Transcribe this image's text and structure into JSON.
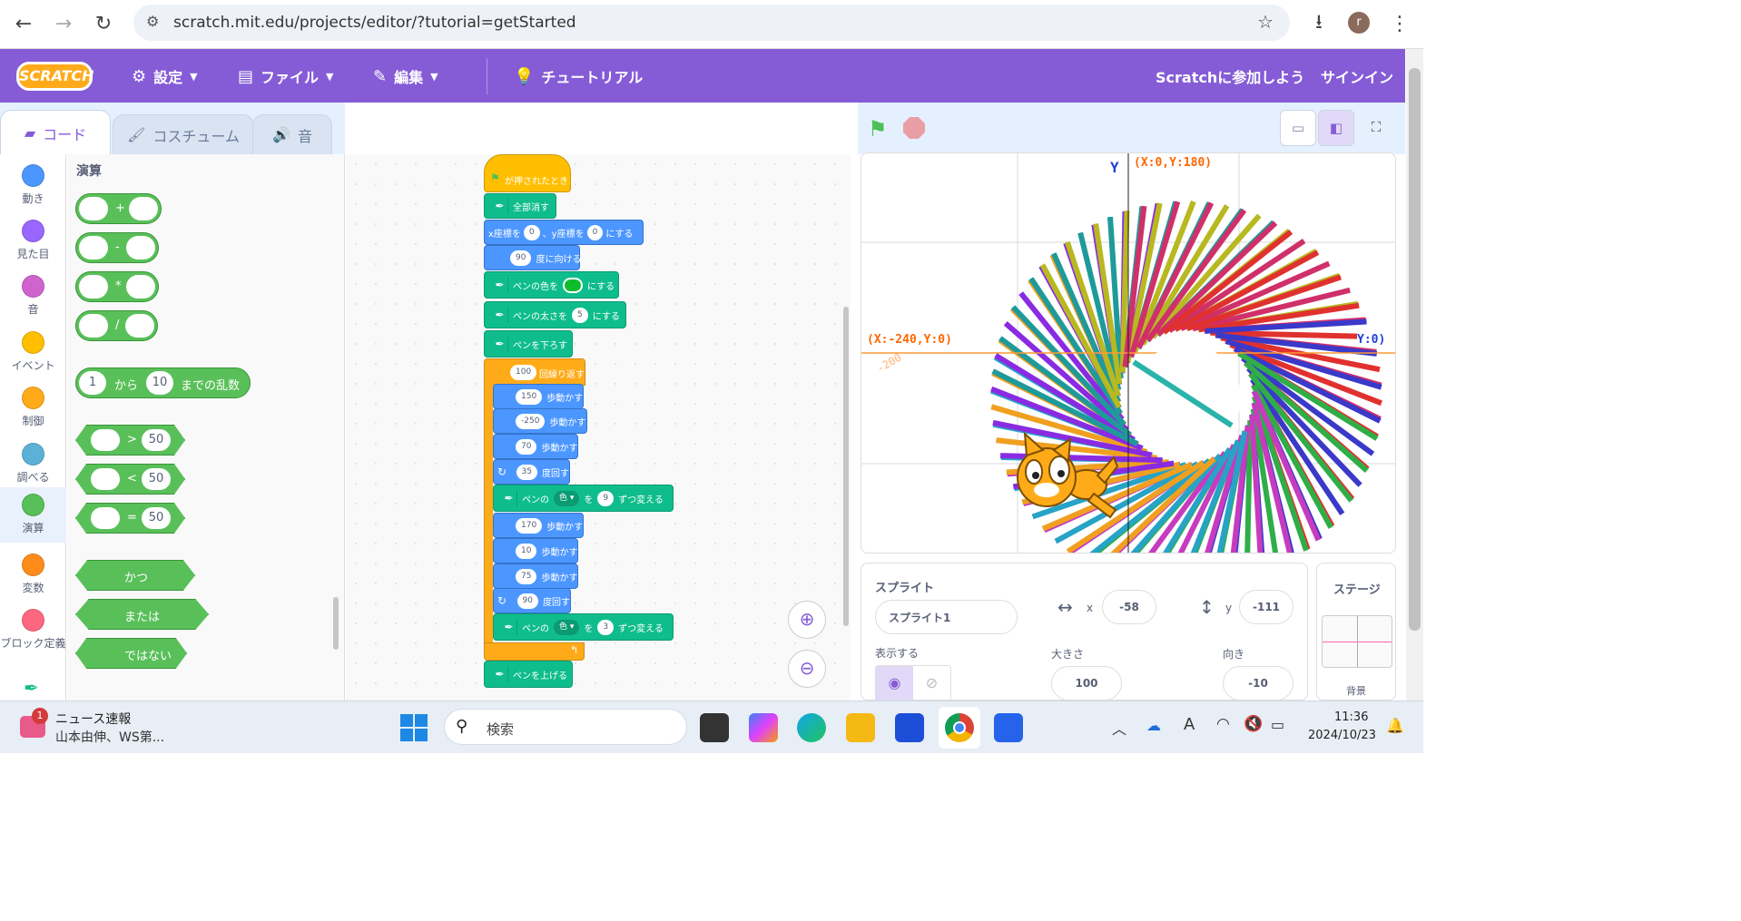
{
  "browser": {
    "url": "scratch.mit.edu/projects/editor/?tutorial=getStarted",
    "profile_initial": "r"
  },
  "menubar": {
    "logo": "SCRATCH",
    "settings": "設定",
    "file": "ファイル",
    "edit": "編集",
    "tutorial": "チュートリアル",
    "join": "Scratchに参加しよう",
    "signin": "サインイン"
  },
  "tabs": {
    "code": "コード",
    "costume": "コスチューム",
    "sound": "音"
  },
  "categories": [
    {
      "label": "動き",
      "color": "#4c97ff"
    },
    {
      "label": "見た目",
      "color": "#9966ff"
    },
    {
      "label": "音",
      "color": "#cf63cf"
    },
    {
      "label": "イベント",
      "color": "#ffbf00"
    },
    {
      "label": "制御",
      "color": "#ffab19"
    },
    {
      "label": "調べる",
      "color": "#5cb1d6"
    },
    {
      "label": "演算",
      "color": "#59c059"
    },
    {
      "label": "変数",
      "color": "#ff8c1a"
    },
    {
      "label": "ブロック定義",
      "color": "#ff6680"
    }
  ],
  "palette": {
    "title": "演算",
    "plus": "+",
    "minus": "-",
    "times": "*",
    "divide": "/",
    "random_from": "1",
    "random_to_label": "から",
    "random_to": "10",
    "random_label": "までの乱数",
    "gt": ">",
    "lt": "<",
    "eq": "=",
    "cmp_value": "50",
    "and": "かつ",
    "or": "または",
    "not": "ではない"
  },
  "script": {
    "hat": "が押されたとき",
    "clear": "全部消す",
    "goto_x_label": "x座標を",
    "goto_x": "0",
    "goto_y_label": "、y座標を",
    "goto_y": "0",
    "goto_end": "にする",
    "point": "90",
    "point_label": "度に向ける",
    "pencolor_label": "ペンの色を",
    "pencolor_end": "にする",
    "pencolor_value": "#0fbd2c",
    "pensize_label": "ペンの太さを",
    "pensize": "5",
    "pensize_end": "にする",
    "pendown": "ペンを下ろす",
    "repeat": "100",
    "repeat_label": "回繰り返す",
    "move1": "150",
    "move_label": "歩動かす",
    "move2": "-250",
    "move3": "70",
    "turn1": "35",
    "turn_label": "度回す",
    "change1_label": "ペンの",
    "change_dd": "色",
    "change_wo": "を",
    "change1": "9",
    "change_end": "ずつ変える",
    "move4": "170",
    "move5": "10",
    "move6": "75",
    "turn2": "90",
    "change2": "3",
    "penup": "ペンを上げる"
  },
  "stage": {
    "y_label": "Y",
    "top_coord": "(X:0,Y:180)",
    "left_coord": "(X:-240,Y:0)",
    "tick_left": "-200",
    "right_coord_partial": "Y:0)"
  },
  "sprite_panel": {
    "title": "スプライト",
    "name": "スプライト1",
    "x_label": "x",
    "x": "-58",
    "y_label": "y",
    "y": "-111",
    "show_label": "表示する",
    "size_label": "大きさ",
    "size": "100",
    "direction_label": "向き",
    "direction": "-10"
  },
  "stage_panel": {
    "title": "ステージ",
    "backdrop": "背景"
  },
  "taskbar": {
    "news_badge": "1",
    "news_title": "ニュース速報",
    "news_sub": "山本由伸、WS第...",
    "search": "検索",
    "time": "11:36",
    "date": "2024/10/23"
  }
}
